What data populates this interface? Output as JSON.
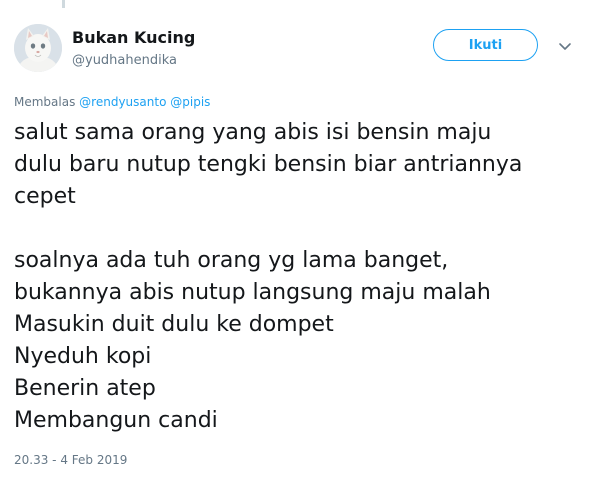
{
  "author": {
    "name": "Bukan Kucing",
    "handle": "@yudhahendika"
  },
  "follow_button": {
    "label": "Ikuti"
  },
  "menu": {
    "icon": "chevron-down-icon"
  },
  "reply_context": {
    "prefix": "Membalas",
    "mentions": [
      "@rendyusanto",
      "@pipis"
    ]
  },
  "tweet": {
    "paragraph1": [
      "salut sama orang yang abis isi bensin maju",
      "dulu baru nutup tengki bensin biar antriannya",
      "cepet"
    ],
    "paragraph2": [
      "soalnya ada tuh orang yg lama banget,",
      "bukannya abis nutup langsung maju malah",
      "Masukin duit dulu ke dompet",
      "Nyeduh kopi",
      "Benerin atep",
      "Membangun candi"
    ]
  },
  "timestamp": "20.33 - 4 Feb 2019",
  "colors": {
    "accent": "#1da1f2",
    "text": "#14171a",
    "secondary": "#657786"
  }
}
